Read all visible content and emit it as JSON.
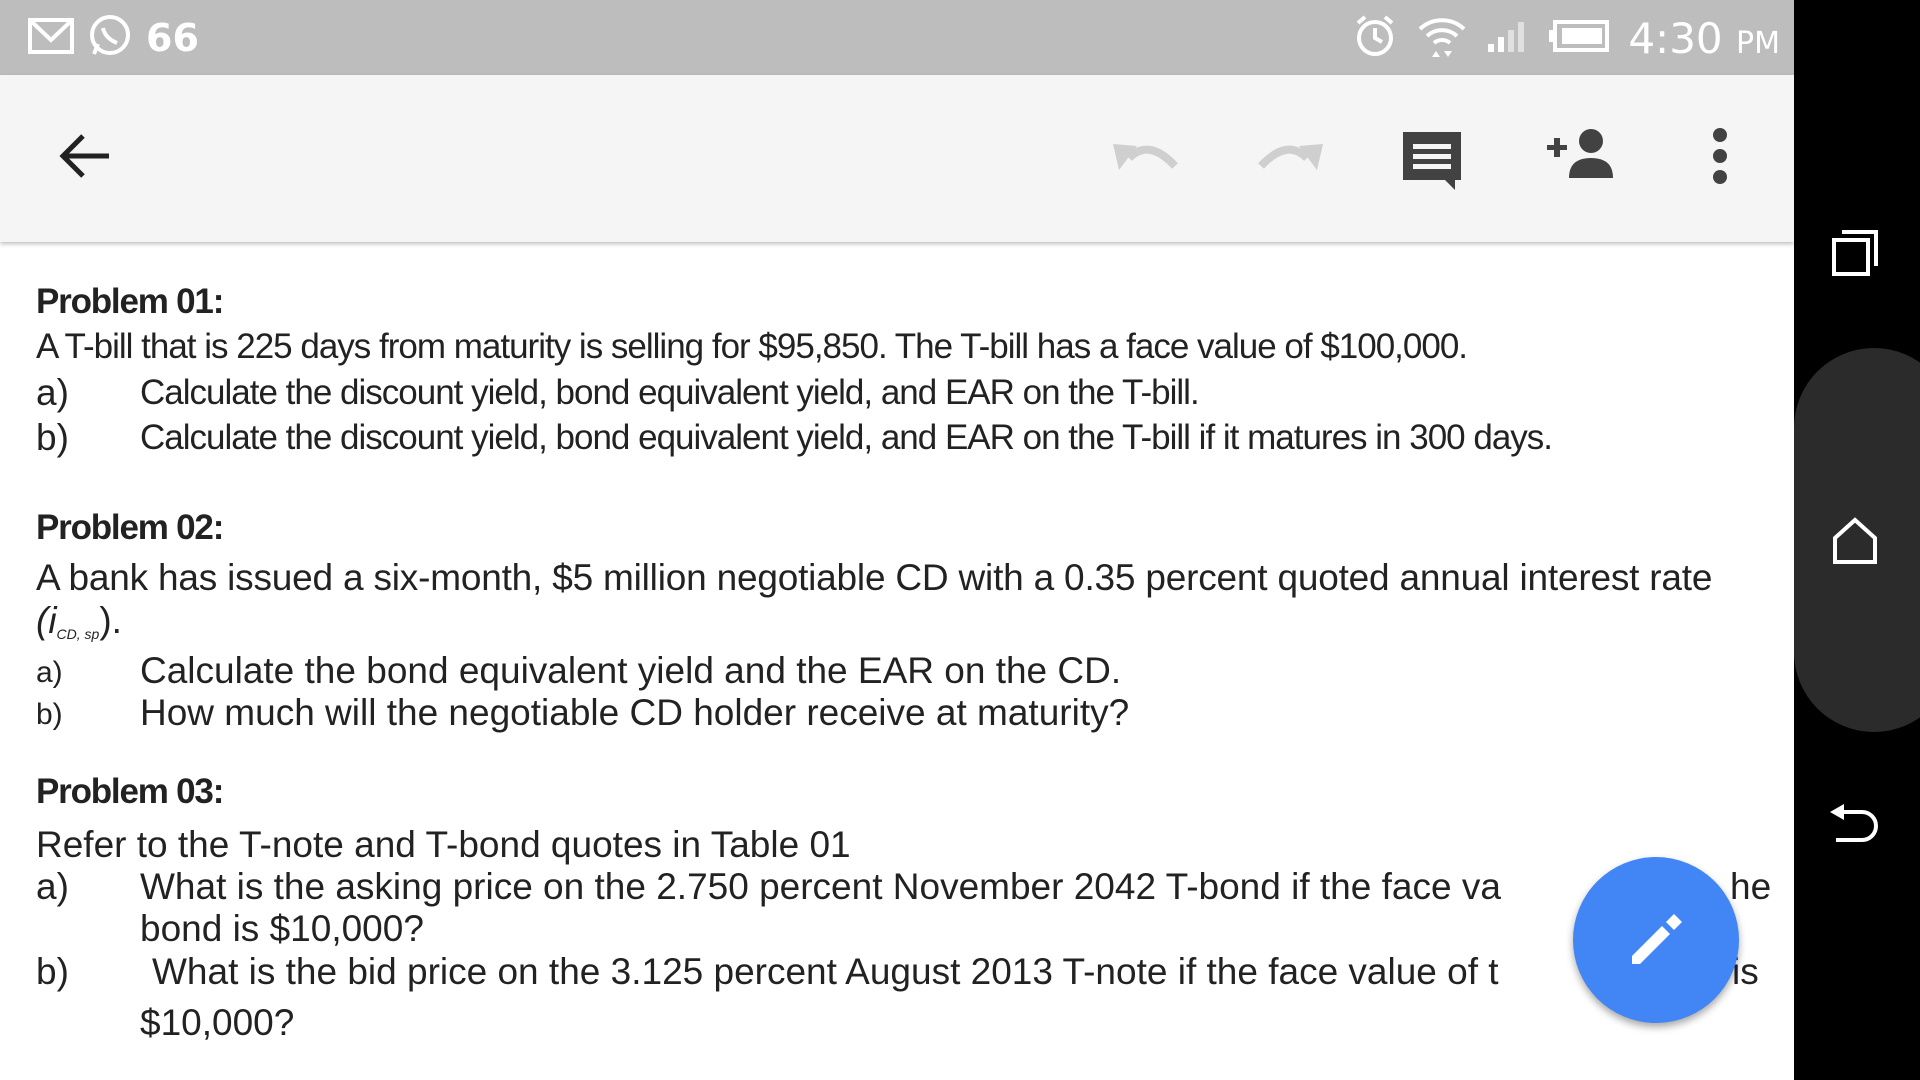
{
  "status_bar": {
    "notification_count": "66",
    "time": "4:30",
    "ampm": "PM"
  },
  "toolbar": {
    "icons": [
      "back-arrow-icon",
      "undo-icon",
      "redo-icon",
      "comment-icon",
      "add-person-icon",
      "more-vert-icon"
    ]
  },
  "document": {
    "problem1": {
      "heading": "Problem 01:",
      "statement": "A T-bill that is 225 days from maturity is selling for $95,850. The T-bill has a face value of $100,000.",
      "items": [
        {
          "label": "a)",
          "text": "Calculate the discount yield, bond equivalent yield, and EAR on the T-bill."
        },
        {
          "label": "b)",
          "text": "Calculate the discount yield, bond equivalent yield, and EAR on the T-bill if it matures in 300 days."
        }
      ]
    },
    "problem2": {
      "heading": "Problem 02:",
      "statement": "A bank has issued a six-month, $5 million negotiable CD with a 0.35 percent quoted annual interest rate",
      "notation_i": "(i",
      "notation_sub": "CD, sp",
      "notation_end": ").",
      "items": [
        {
          "label": "a)",
          "text": "Calculate the bond equivalent yield and the EAR on the CD."
        },
        {
          "label": "b)",
          "text": "How much will the negotiable CD holder receive at maturity?"
        }
      ]
    },
    "problem3": {
      "heading": "Problem 03:",
      "statement": "Refer to the T-note and T-bond quotes in Table 01",
      "items": [
        {
          "label": "a)",
          "line1": "What is the asking price on the 2.750 percent November 2042 T-bond if the face va",
          "line1_end": "he",
          "line2": "bond is $10,000?"
        },
        {
          "label": "b)",
          "line1": "What is the bid price on the 3.125 percent August 2013 T-note if the face value of t",
          "line1_end": "is",
          "line2": "$10,000?"
        }
      ]
    }
  },
  "colors": {
    "status_bar": "#bdbdbd",
    "toolbar": "#f5f5f5",
    "nav_bar": "#000000",
    "fab": "#4285f4",
    "icon": "#424242"
  }
}
